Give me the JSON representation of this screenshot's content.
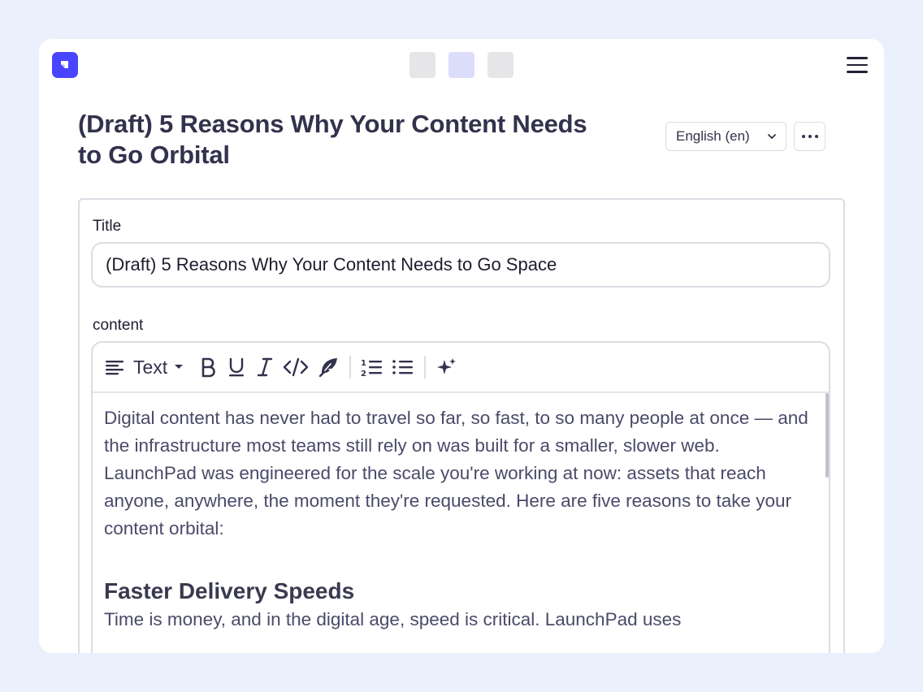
{
  "header": {
    "tabs": [
      "tab-1",
      "tab-2",
      "tab-3"
    ],
    "menu_icon": "hamburger-icon",
    "logo_icon": "app-logo-icon"
  },
  "page": {
    "title": "(Draft) 5 Reasons Why Your Content Needs to Go Orbital",
    "language_select": "English (en)",
    "more_icon": "more-dots-icon"
  },
  "form": {
    "title_label": "Title",
    "title_value": "(Draft) 5 Reasons Why Your Content Needs to Go Space",
    "content_label": "content",
    "toolbar": {
      "block_type": "Text",
      "buttons": [
        "align-icon",
        "bold-icon",
        "underline-icon",
        "italic-icon",
        "code-icon",
        "quill-icon",
        "ordered-list-icon",
        "bullet-list-icon",
        "ai-sparkle-icon"
      ]
    },
    "body": {
      "paragraph": "Digital content has never had to travel so far, so fast, to so many people at once — and the infrastructure most teams still rely on was built for a smaller, slower web. LaunchPad was engineered for the scale you're working at now: assets that reach anyone, anywhere, the moment they're requested. Here are five reasons to take your content orbital:",
      "heading": "Faster Delivery Speeds",
      "paragraph2": "Time is money, and in the digital age, speed is critical. LaunchPad uses"
    }
  },
  "colors": {
    "accent": "#4945ff",
    "background": "#ebf1fc",
    "text_dark": "#32324d"
  }
}
